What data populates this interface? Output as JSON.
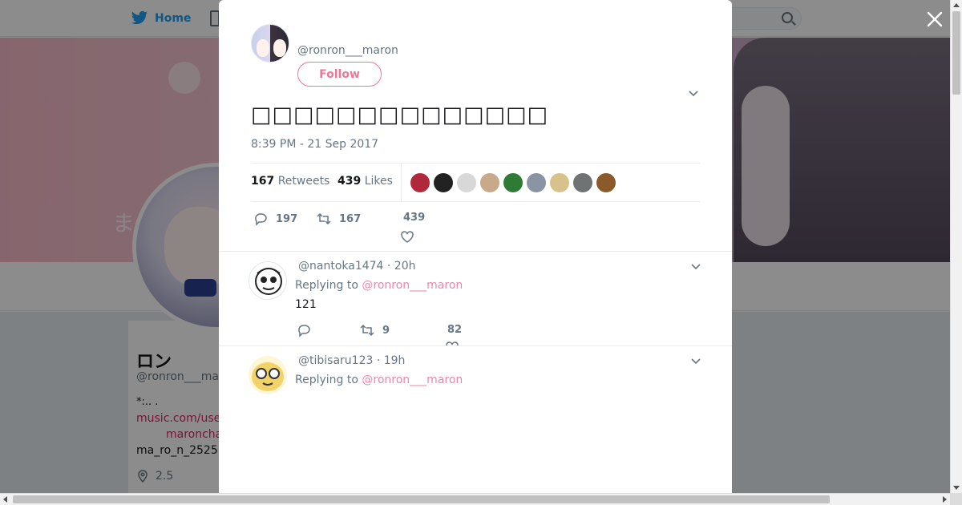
{
  "background": {
    "nav_home_label": "Home",
    "profile": {
      "display_name": "ロン",
      "handle": "@ronron___ma",
      "bio_line1": "*:.. .",
      "bio_line1_link": "n",
      "bio_line2": "music.com/use",
      "bio_line3": "maroncha",
      "bio_line4": "ma_ro_n_2525",
      "location": "2.5"
    }
  },
  "modal": {
    "close_label": "×",
    "author_handle": "@ronron___maron",
    "follow_label": "Follow",
    "tweet_text": "□□□□□□□□□□□□□□",
    "timestamp": "8:39 PM - 21 Sep 2017",
    "stats": {
      "retweets_count": "167",
      "retweets_label": "Retweets",
      "likes_count": "439",
      "likes_label": "Likes"
    },
    "likers": [
      "#b0293a",
      "#222222",
      "#d8d8d8",
      "#c8a98a",
      "#2f7a35",
      "#8a94a2",
      "#d8c28c",
      "#6f7374",
      "#8a5a2a"
    ],
    "actions": {
      "reply_count": "197",
      "retweet_count": "167",
      "like_count": "439"
    },
    "replies": [
      {
        "handle_time": "@nantoka1474 · 20h",
        "replying_label": "Replying to",
        "replying_to": "@ronron___maron",
        "text": "121",
        "retweet_count": "9",
        "like_count": "82"
      },
      {
        "handle_time": "@tibisaru123 · 19h",
        "replying_label": "Replying to",
        "replying_to": "@ronron___maron"
      }
    ]
  },
  "colors": {
    "accent": "#e81c4f",
    "link": "#e0245e",
    "muted": "#657786",
    "text": "#14171a"
  }
}
